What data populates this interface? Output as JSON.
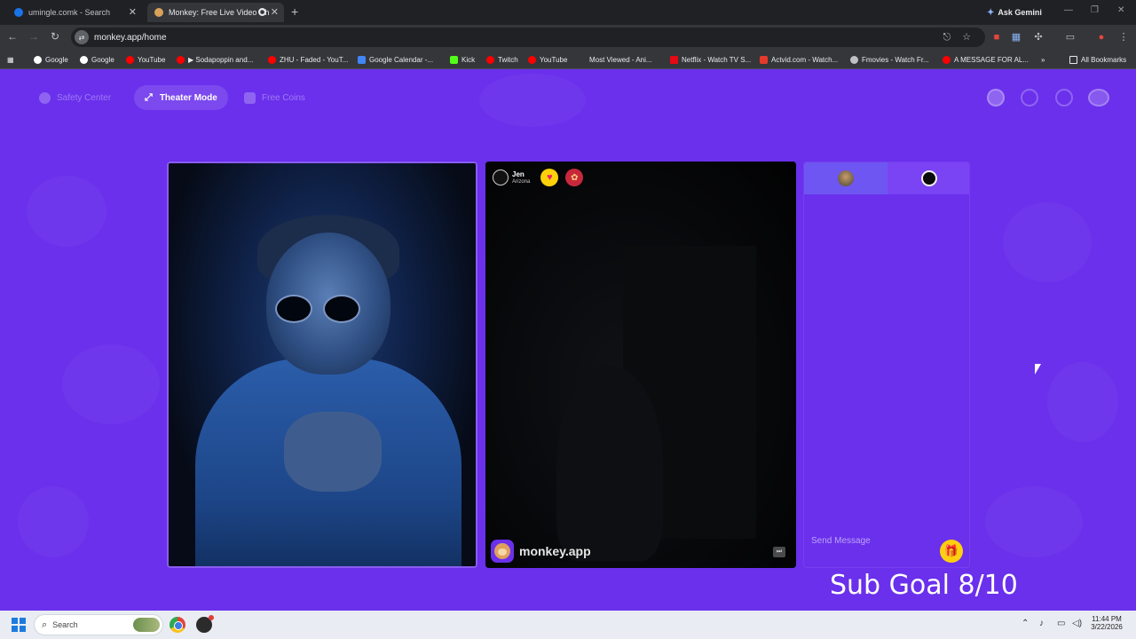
{
  "browser": {
    "tabs": [
      {
        "title": "umingle.comk - Search"
      },
      {
        "title": "Monkey: Free Live Video Ch"
      }
    ],
    "ask_gemini": "Ask Gemini",
    "url": "monkey.app/home",
    "bookmarks": [
      {
        "label": "Google",
        "color": "#ffffff"
      },
      {
        "label": "Google",
        "color": "#ffffff"
      },
      {
        "label": "YouTube",
        "color": "#ff0000"
      },
      {
        "label": "▶ Sodapoppin and...",
        "color": "#ff0000"
      },
      {
        "label": "ZHU - Faded - YouT...",
        "color": "#ff0000"
      },
      {
        "label": "Google Calendar -...",
        "color": "#4285f4"
      },
      {
        "label": "Kick",
        "color": "#53fc18"
      },
      {
        "label": "Twitch",
        "color": "#ff0000"
      },
      {
        "label": "YouTube",
        "color": "#ff0000"
      },
      {
        "label": "Most Viewed - Ani...",
        "color": "#35363a"
      },
      {
        "label": "Netflix - Watch TV S...",
        "color": "#e50914"
      },
      {
        "label": "Actvid.com - Watch...",
        "color": "#e5392a"
      },
      {
        "label": "Fmovies - Watch Fr...",
        "color": "#bdc1c6"
      },
      {
        "label": "A MESSAGE FOR AL...",
        "color": "#ff0000"
      }
    ],
    "all_bookmarks": "All Bookmarks"
  },
  "app": {
    "brand_color": "#6a30ec",
    "nav": {
      "safety_center": "Safety Center",
      "theater_mode": "Theater Mode",
      "free_coins": "Free Coins"
    },
    "match": {
      "name": "Jen",
      "location": "Arizona"
    },
    "watermark": "monkey.app",
    "chat": {
      "placeholder": "Send Message"
    },
    "overlay_text": "Sub Goal 8/10"
  },
  "taskbar": {
    "search_placeholder": "Search",
    "time": "11:44 PM",
    "date": "3/22/2026"
  }
}
